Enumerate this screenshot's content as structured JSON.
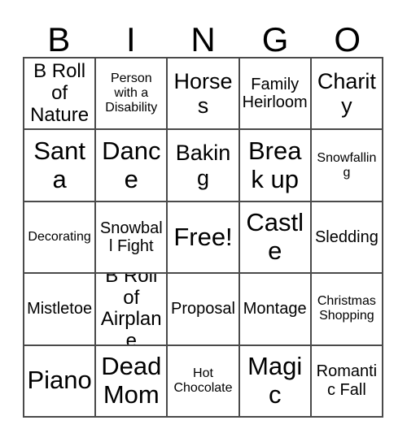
{
  "card": {
    "title": "BINGO",
    "header_letters": [
      "B",
      "I",
      "N",
      "G",
      "O"
    ],
    "free_space_label": "Free!",
    "colors": {
      "background": "#ffffff",
      "grid_line": "#4a4a4a",
      "text": "#000000"
    },
    "grid": {
      "columns": 5,
      "rows": 5,
      "cells": [
        {
          "text": "B Roll of Nature",
          "size": "lg"
        },
        {
          "text": "Person with a Disability",
          "size": "sm"
        },
        {
          "text": "Horses",
          "size": "xl"
        },
        {
          "text": "Family Heirloom",
          "size": "md"
        },
        {
          "text": "Charity",
          "size": "xl"
        },
        {
          "text": "Santa",
          "size": "xxl"
        },
        {
          "text": "Dance",
          "size": "xxl"
        },
        {
          "text": "Baking",
          "size": "xl"
        },
        {
          "text": "Break up",
          "size": "xxl"
        },
        {
          "text": "Snowfalling",
          "size": "sm"
        },
        {
          "text": "Decorating",
          "size": "sm"
        },
        {
          "text": "Snowball Fight",
          "size": "md"
        },
        {
          "text": "Free!",
          "size": "xxl"
        },
        {
          "text": "Castle",
          "size": "xxl"
        },
        {
          "text": "Sledding",
          "size": "md"
        },
        {
          "text": "Mistletoe",
          "size": "md"
        },
        {
          "text": "B Roll of Airplane",
          "size": "lg"
        },
        {
          "text": "Proposal",
          "size": "md"
        },
        {
          "text": "Montage",
          "size": "md"
        },
        {
          "text": "Christmas Shopping",
          "size": "sm"
        },
        {
          "text": "Piano",
          "size": "xxl"
        },
        {
          "text": "Dead Mom",
          "size": "xxl"
        },
        {
          "text": "Hot Chocolate",
          "size": "sm"
        },
        {
          "text": "Magic",
          "size": "xxl"
        },
        {
          "text": "Romantic Fall",
          "size": "md"
        }
      ]
    }
  }
}
